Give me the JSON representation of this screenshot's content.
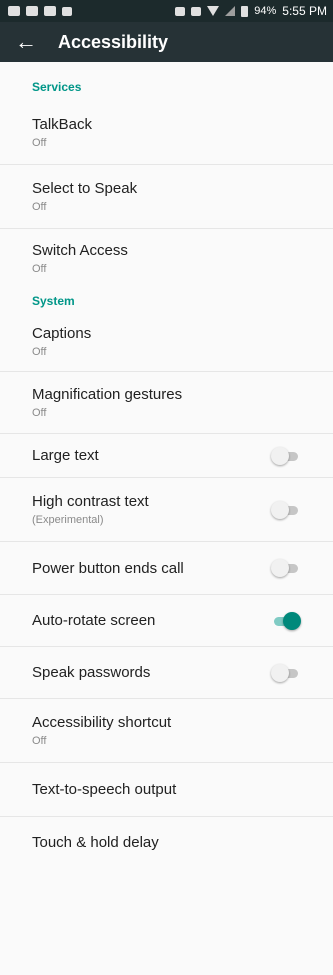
{
  "status_bar": {
    "battery": "94%",
    "time": "5:55 PM"
  },
  "app_bar": {
    "back_icon": "arrow-left-icon",
    "title": "Accessibility"
  },
  "sections": {
    "services": "Services",
    "system": "System"
  },
  "items": {
    "talkback": {
      "title": "TalkBack",
      "sub": "Off"
    },
    "select_to_speak": {
      "title": "Select to Speak",
      "sub": "Off"
    },
    "switch_access": {
      "title": "Switch Access",
      "sub": "Off"
    },
    "captions": {
      "title": "Captions",
      "sub": "Off"
    },
    "magnification": {
      "title": "Magnification gestures",
      "sub": "Off"
    },
    "large_text": {
      "title": "Large text",
      "enabled": false
    },
    "high_contrast": {
      "title": "High contrast text",
      "sub": "(Experimental)",
      "enabled": false
    },
    "power_button": {
      "title": "Power button ends call",
      "enabled": false
    },
    "auto_rotate": {
      "title": "Auto-rotate screen",
      "enabled": true
    },
    "speak_passwords": {
      "title": "Speak passwords",
      "enabled": false
    },
    "shortcut": {
      "title": "Accessibility shortcut",
      "sub": "Off"
    },
    "tts_output": {
      "title": "Text-to-speech output"
    },
    "touch_hold": {
      "title": "Touch & hold delay"
    }
  },
  "colors": {
    "accent": "#009688",
    "app_bar": "#263236",
    "status_bar": "#1c2a2c"
  }
}
